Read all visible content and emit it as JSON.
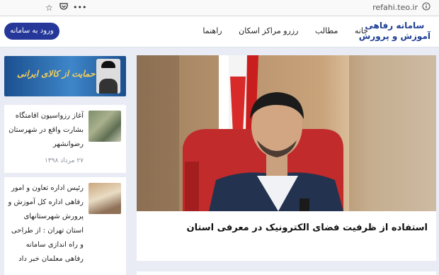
{
  "browser": {
    "url": "refahi.teo.ir",
    "dots": "•••"
  },
  "site": {
    "logo_line1": "سامانه رفاهی",
    "logo_line2": "آموزش و پرورش",
    "menu": [
      "خانه",
      "مطالب",
      "رزرو مراکز اسکان",
      "راهنما"
    ],
    "login": "ورود به سامانه"
  },
  "banner": {
    "text": "سال حمایت از کالای ایرانی"
  },
  "news": [
    {
      "title": "آغاز رزواسیون اقامتگاه بشارت واقع در شهرستان رضوانشهر",
      "date": "۲۷ مرداد ۱۳۹۸"
    },
    {
      "title": "رئیس اداره تعاون و امور رفاهی اداره کل آموزش و پرورش شهرستانهای استان تهران : از طراحی و راه اندازی سامانه رفاهی معلمان خبر داد",
      "date": ""
    }
  ],
  "featured": {
    "title": "استفاده از ظرفیت فضای الکترونیک در معرفی استان"
  }
}
